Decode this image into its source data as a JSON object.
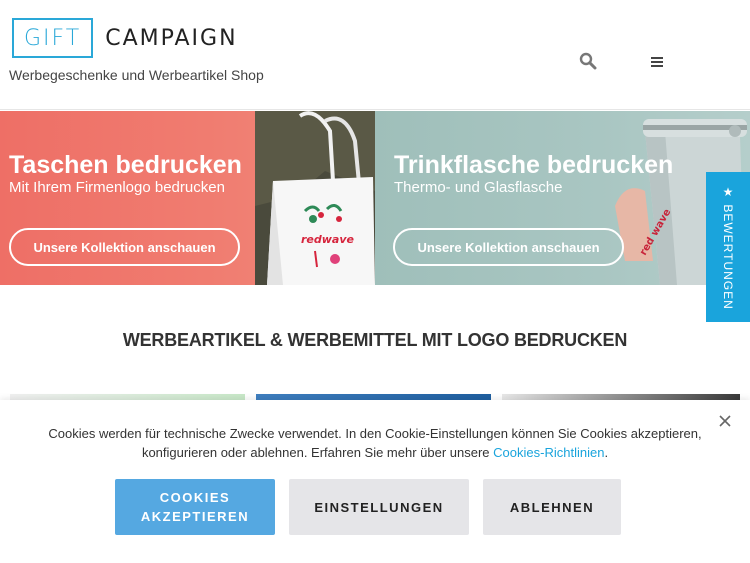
{
  "header": {
    "logo_left": "GIFT",
    "logo_right": "CAMPAIGN",
    "tagline": "Werbegeschenke und Werbeartikel Shop",
    "search_icon": "search-icon",
    "menu_icon": "hamburger-menu-icon"
  },
  "hero": [
    {
      "title": "Taschen bedrucken",
      "subtitle": "Mit Ihrem Firmenlogo bedrucken",
      "button": "Unsere Kollektion anschauen",
      "brand_text": "redwave"
    },
    {
      "title": "Trinkflasche bedrucken",
      "subtitle": "Thermo- und Glasflasche",
      "button": "Unsere Kollektion anschauen",
      "brand_text": "red wave"
    }
  ],
  "side_tab": {
    "label": "★ BEWERTUNGEN"
  },
  "section": {
    "title": "WERBEARTIKEL & WERBEMITTEL MIT LOGO BEDRUCKEN"
  },
  "cookie": {
    "text": "Cookies werden für technische Zwecke verwendet. In den Cookie-Einstellungen können Sie Cookies akzeptieren, konfigurieren oder ablehnen. Erfahren Sie mehr über unsere ",
    "link": "Cookies-Richtlinien",
    "link_suffix": ".",
    "accept_line1": "COOKIES",
    "accept_line2": "AKZEPTIEREN",
    "settings": "EINSTELLUNGEN",
    "reject": "ABLEHNEN",
    "close_icon": "close-icon"
  },
  "colors": {
    "brand_blue": "#2aa8d8",
    "accent_blue": "#1aa4dc",
    "hero_left_bg": "#ee6f66",
    "hero_right_bg": "#a9c6c2",
    "accept_bg": "#55a8e1",
    "secondary_bg": "#e5e5e8"
  }
}
